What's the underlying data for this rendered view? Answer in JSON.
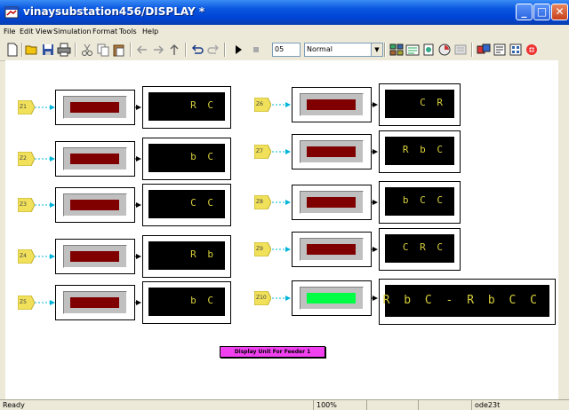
{
  "window": {
    "title": "vinaysubstation456/DISPLAY *",
    "minimize_label": "_",
    "maximize_label": "□",
    "close_label": "✕"
  },
  "menu": [
    "File",
    "Edit",
    "View",
    "Simulation",
    "Format",
    "Tools",
    "Help"
  ],
  "toolbar": {
    "icons": [
      "new-icon",
      "open-icon",
      "save-icon",
      "print-icon",
      "cut-icon",
      "copy-icon",
      "paste-icon",
      "back-icon",
      "forward-icon",
      "up-icon",
      "undo-icon",
      "redo-icon",
      "start-icon",
      "stop-icon",
      "library-browser-icon",
      "model-explorer-icon",
      "debugger-icon",
      "profiler-icon",
      "library-icon",
      "toggle-explorer-icon",
      "sim-browser-icon",
      "model-advisor-icon",
      "ltiviewer-icon"
    ],
    "stop_time": "05",
    "sim_mode": "Normal",
    "dropdown_glyph": "▼"
  },
  "blocks": {
    "left": [
      {
        "tag": "Z1",
        "lamp_color": "#800000",
        "display": "R C"
      },
      {
        "tag": "Z2",
        "lamp_color": "#800000",
        "display": "b C"
      },
      {
        "tag": "Z3",
        "lamp_color": "#800000",
        "display": "C C"
      },
      {
        "tag": "Z4",
        "lamp_color": "#800000",
        "display": "R b"
      },
      {
        "tag": "Z5",
        "lamp_color": "#800000",
        "display": "b C"
      }
    ],
    "right": [
      {
        "tag": "Z6",
        "lamp_color": "#800000",
        "display": "C R"
      },
      {
        "tag": "Z7",
        "lamp_color": "#800000",
        "display": "R b C"
      },
      {
        "tag": "Z8",
        "lamp_color": "#800000",
        "display": "b C C"
      },
      {
        "tag": "Z9",
        "lamp_color": "#800000",
        "display": "C R C"
      },
      {
        "tag": "Z10",
        "lamp_color": "#00ff44",
        "display": "R b C - R b C C"
      }
    ]
  },
  "annotation": "Display Unit For Feeder 1",
  "status": {
    "text": "Ready",
    "zoom": "100%",
    "solver": "ode23t"
  },
  "colors": {
    "titlebar": "#0a57e0",
    "goto_tag": "#f0e05a",
    "signal_line": "#00b4d8",
    "annotation_bg": "#f040f0",
    "digit": "#d7cf3c"
  }
}
